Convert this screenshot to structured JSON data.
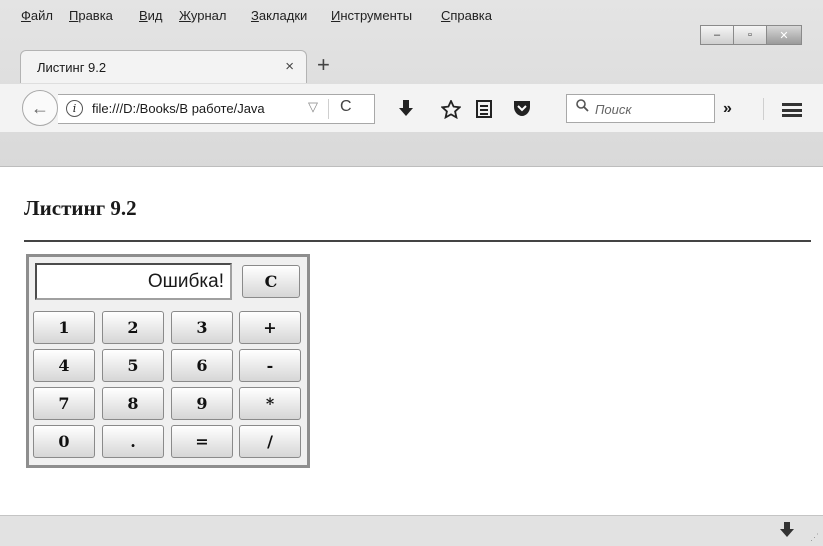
{
  "menu": [
    "Файл",
    "Правка",
    "Вид",
    "Журнал",
    "Закладки",
    "Инструменты",
    "Справка"
  ],
  "window_controls": {
    "minimize": "–",
    "maximize": "▫",
    "close": "✕"
  },
  "tab": {
    "title": "Листинг 9.2",
    "close": "×",
    "new_tab": "+"
  },
  "navbar": {
    "back": "←",
    "url": "file:///D:/Books/В работе/Java",
    "url_dropdown": "▽",
    "reload": "C",
    "search_placeholder": "Поиск",
    "overflow": "»"
  },
  "icons": {
    "back": "arrow-left-icon",
    "info": "info-icon",
    "reload": "reload-icon",
    "downloads": "download-icon",
    "bookmark_star": "star-icon",
    "reader": "reading-list-icon",
    "pocket": "pocket-icon",
    "search": "search-icon",
    "menu": "hamburger-menu-icon"
  },
  "page": {
    "title": "Листинг 9.2"
  },
  "calculator": {
    "display_value": "Ошибка!",
    "clear_label": "C",
    "keys": [
      [
        "1",
        "2",
        "3",
        "+"
      ],
      [
        "4",
        "5",
        "6",
        "-"
      ],
      [
        "7",
        "8",
        "9",
        "*"
      ],
      [
        "0",
        ".",
        "=",
        "/"
      ]
    ]
  }
}
